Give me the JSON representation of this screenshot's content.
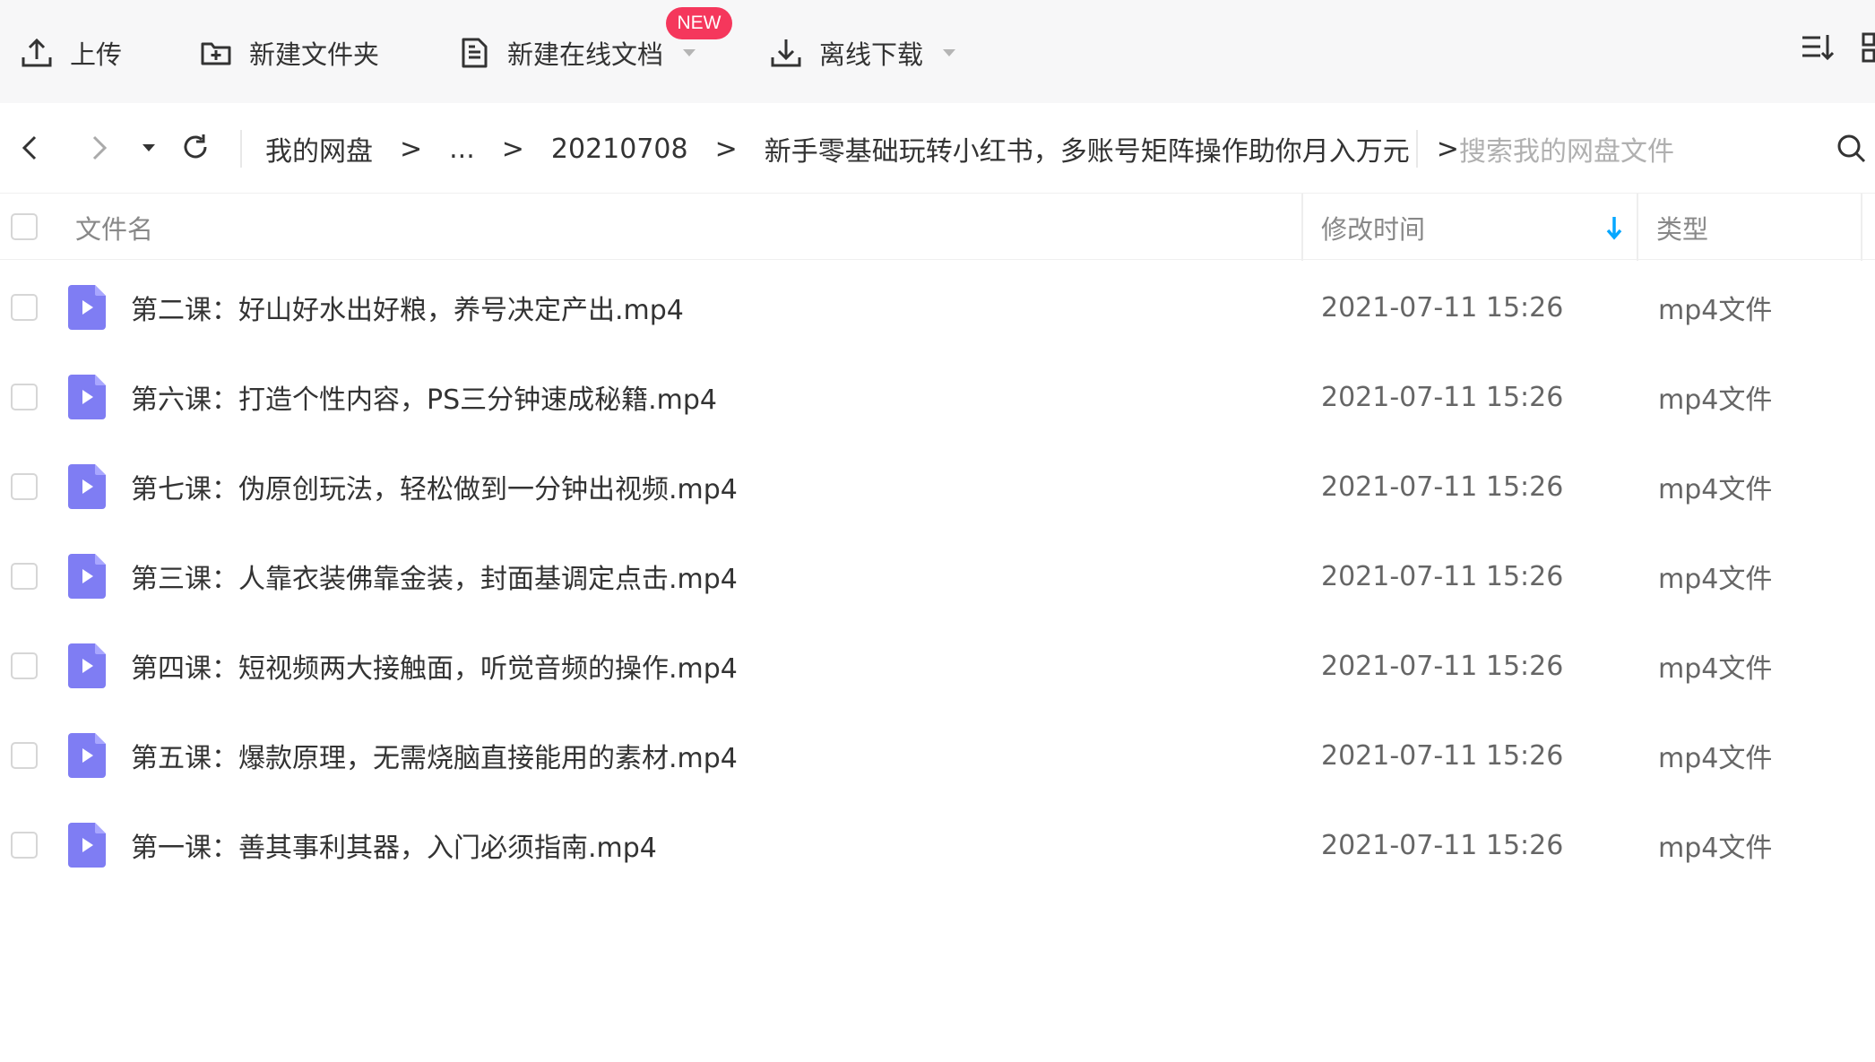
{
  "toolbar": {
    "upload_label": "上传",
    "new_folder_label": "新建文件夹",
    "new_online_doc_label": "新建在线文档",
    "new_badge": "NEW",
    "offline_download_label": "离线下载"
  },
  "nav": {
    "breadcrumbs": [
      "我的网盘",
      "...",
      "20210708",
      "新手零基础玩转小红书，多账号矩阵操作助你月入万元"
    ],
    "separator": ">",
    "search_placeholder": "搜索我的网盘文件"
  },
  "table": {
    "headers": {
      "name": "文件名",
      "modified": "修改时间",
      "type": "类型"
    },
    "rows": [
      {
        "name": "第二课：好山好水出好粮，养号决定产出.mp4",
        "modified": "2021-07-11 15:26",
        "type": "mp4文件"
      },
      {
        "name": "第六课：打造个性内容，PS三分钟速成秘籍.mp4",
        "modified": "2021-07-11 15:26",
        "type": "mp4文件"
      },
      {
        "name": "第七课：伪原创玩法，轻松做到一分钟出视频.mp4",
        "modified": "2021-07-11 15:26",
        "type": "mp4文件"
      },
      {
        "name": "第三课：人靠衣装佛靠金装，封面基调定点击.mp4",
        "modified": "2021-07-11 15:26",
        "type": "mp4文件"
      },
      {
        "name": "第四课：短视频两大接触面，听觉音频的操作.mp4",
        "modified": "2021-07-11 15:26",
        "type": "mp4文件"
      },
      {
        "name": "第五课：爆款原理，无需烧脑直接能用的素材.mp4",
        "modified": "2021-07-11 15:26",
        "type": "mp4文件"
      },
      {
        "name": "第一课：善其事利其器，入门必须指南.mp4",
        "modified": "2021-07-11 15:26",
        "type": "mp4文件"
      }
    ]
  },
  "colors": {
    "accent": "#06a7ff",
    "badge": "#f5375c",
    "video_icon": "#7f7df3"
  }
}
